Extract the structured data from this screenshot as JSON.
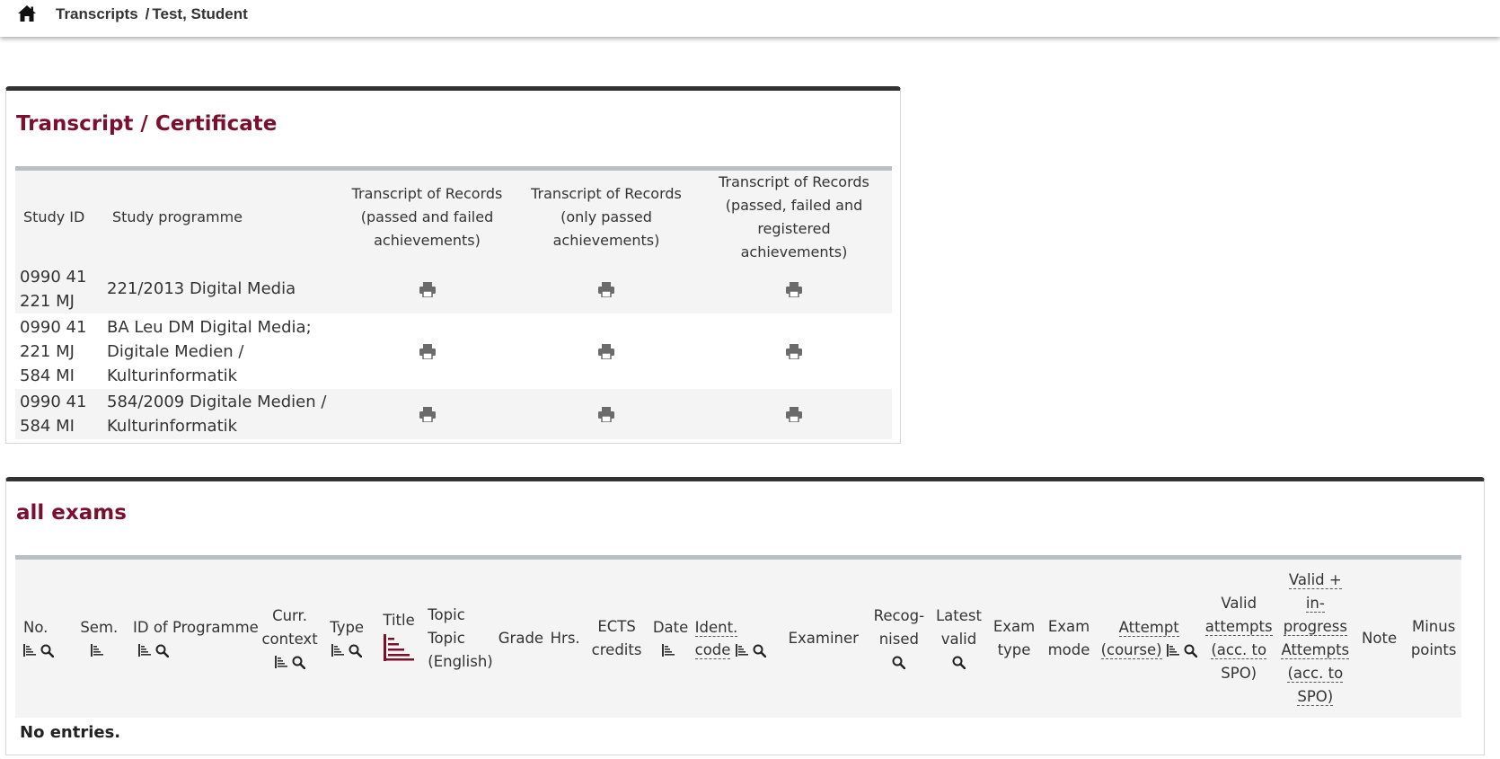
{
  "breadcrumb": {
    "link": "Transcripts",
    "separator": "/",
    "current": "Test, Student"
  },
  "transcript_panel": {
    "title": "Transcript / Certificate",
    "headers": {
      "study_id": "Study ID",
      "study_programme": "Study programme",
      "tor_all": [
        "Transcript of Records",
        "(passed and failed",
        "achievements)"
      ],
      "tor_passed": [
        "Transcript of Records",
        "(only passed",
        "achievements)"
      ],
      "tor_registered": [
        "Transcript of Records",
        "(passed, failed and registered",
        "achievements)"
      ]
    },
    "rows": [
      {
        "study_id": [
          "0990 41",
          "221 MJ"
        ],
        "programme": [
          "221/2013 Digital Media"
        ]
      },
      {
        "study_id": [
          "0990 41",
          "221 MJ",
          "584 MI"
        ],
        "programme": [
          "BA Leu DM Digital Media;",
          "Digitale Medien /",
          "Kulturinformatik"
        ]
      },
      {
        "study_id": [
          "0990 41",
          "584 MI"
        ],
        "programme": [
          "584/2009 Digitale Medien /",
          "Kulturinformatik"
        ]
      }
    ],
    "print_icon": "print-icon"
  },
  "exams_panel": {
    "title": "all exams",
    "headers": {
      "no": "No.",
      "sem": "Sem.",
      "id_programme": "ID of Programme",
      "curr_context": [
        "Curr.",
        "context"
      ],
      "type": "Type",
      "title": "Title",
      "topic": [
        "Topic",
        "Topic",
        "(English)"
      ],
      "grade": "Grade",
      "hrs": "Hrs.",
      "ects": [
        "ECTS",
        "credits"
      ],
      "date": "Date",
      "ident_code": [
        "Ident.",
        "code"
      ],
      "examiner": "Examiner",
      "recognised": [
        "Recog-",
        "nised"
      ],
      "latest_valid": [
        "Latest",
        "valid"
      ],
      "exam_type": [
        "Exam",
        "type"
      ],
      "exam_mode": [
        "Exam",
        "mode"
      ],
      "attempt_course": [
        "Attempt",
        "(course)"
      ],
      "valid_attempts": [
        "Valid",
        "attempts",
        "(acc. to",
        "SPO)"
      ],
      "valid_inprogress": [
        "Valid +",
        "in-",
        "progress",
        "Attempts",
        "(acc. to",
        "SPO)"
      ],
      "note": "Note",
      "minus_points": [
        "Minus",
        "points"
      ]
    },
    "empty_message": "No entries."
  },
  "colors": {
    "accent": "#7a0f2e",
    "header_bg": "#f4f4f4",
    "rule": "#b9c0c4"
  }
}
